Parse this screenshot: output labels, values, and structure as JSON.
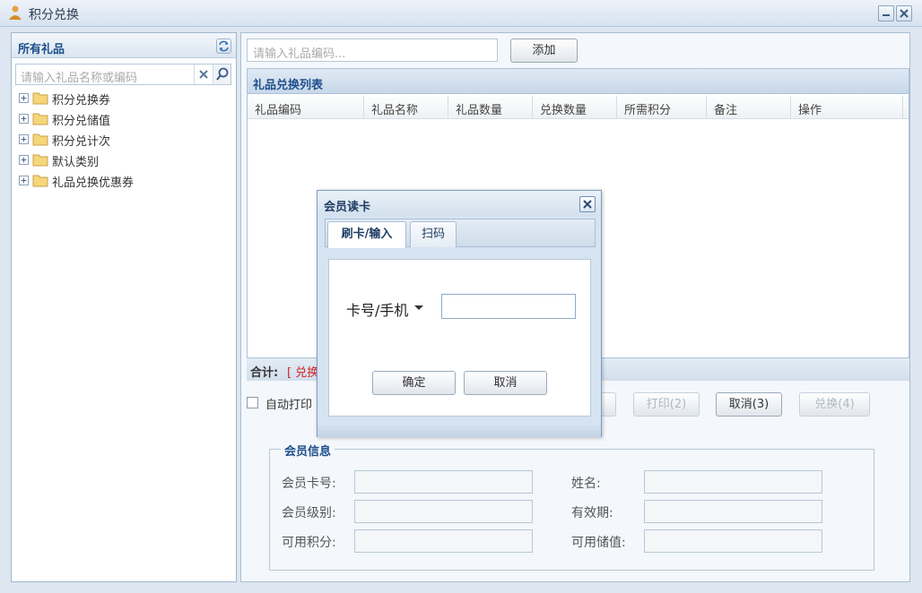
{
  "window": {
    "title": "积分兑换"
  },
  "left": {
    "title": "所有礼品",
    "search_placeholder": "请输入礼品名称或编码",
    "tree": [
      {
        "label": "积分兑换券"
      },
      {
        "label": "积分兑储值"
      },
      {
        "label": "积分兑计次"
      },
      {
        "label": "默认类别"
      },
      {
        "label": "礼品兑换优惠券"
      }
    ]
  },
  "right": {
    "code_placeholder": "请输入礼品编码...",
    "add_label": "添加",
    "grid": {
      "title": "礼品兑换列表",
      "columns": [
        "礼品编码",
        "礼品名称",
        "礼品数量",
        "兑换数量",
        "所需积分",
        "备注",
        "操作"
      ]
    },
    "summary_label": "合计:",
    "summary_value": "[ 兑换",
    "auto_print_label": "自动打印",
    "buttons": {
      "print": "打印(2)",
      "cancel": "取消(3)",
      "exchange": "兑换(4)"
    },
    "member": {
      "legend": "会员信息",
      "card_no": "会员卡号:",
      "level": "会员级别:",
      "points": "可用积分:",
      "name": "姓名:",
      "expiry": "有效期:",
      "balance": "可用储值:"
    }
  },
  "modal": {
    "title": "会员读卡",
    "tabs": [
      "刷卡/输入",
      "扫码"
    ],
    "card_label": "卡号/手机",
    "ok_label": "确定",
    "cancel_label": "取消"
  },
  "colors": {
    "accent": "#1e4f8a",
    "summary": "#d02020"
  }
}
